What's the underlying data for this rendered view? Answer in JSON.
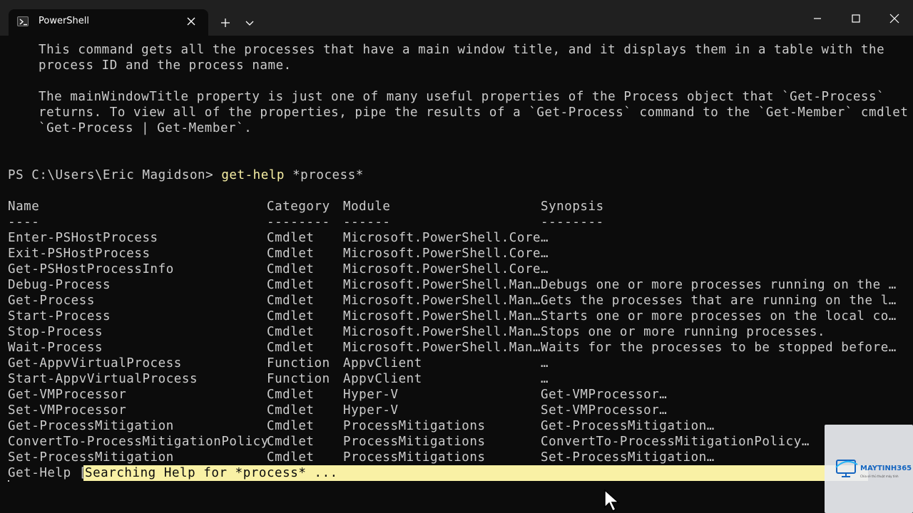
{
  "window": {
    "tab_title": "PowerShell"
  },
  "help_text": {
    "line1": "This command gets all the processes that have a main window title, and it displays them in a table with the",
    "line2": "process ID and the process name.",
    "line3": "The mainWindowTitle property is just one of many useful properties of the Process object that `Get-Process`",
    "line4": "returns. To view all of the properties, pipe the results of a `Get-Process` command to the `Get-Member` cmdlet",
    "line5": "`Get-Process | Get-Member`."
  },
  "prompt": {
    "path": "PS C:\\Users\\Eric Magidson> ",
    "command": "get-help",
    "argument": " *process*"
  },
  "table": {
    "headers": {
      "name": "Name",
      "category": "Category",
      "module": "Module",
      "synopsis": "Synopsis"
    },
    "underlines": {
      "name": "----",
      "category": "--------",
      "module": "------",
      "synopsis": "--------"
    },
    "rows": [
      {
        "name": "Enter-PSHostProcess",
        "category": "Cmdlet",
        "module": "Microsoft.PowerShell.Core",
        "synopsis": "…"
      },
      {
        "name": "Exit-PSHostProcess",
        "category": "Cmdlet",
        "module": "Microsoft.PowerShell.Core",
        "synopsis": "…"
      },
      {
        "name": "Get-PSHostProcessInfo",
        "category": "Cmdlet",
        "module": "Microsoft.PowerShell.Core",
        "synopsis": "…"
      },
      {
        "name": "Debug-Process",
        "category": "Cmdlet",
        "module": "Microsoft.PowerShell.Man…",
        "synopsis": "Debugs one or more processes running on the …"
      },
      {
        "name": "Get-Process",
        "category": "Cmdlet",
        "module": "Microsoft.PowerShell.Man…",
        "synopsis": "Gets the processes that are running on the l…"
      },
      {
        "name": "Start-Process",
        "category": "Cmdlet",
        "module": "Microsoft.PowerShell.Man…",
        "synopsis": "Starts one or more processes on the local co…"
      },
      {
        "name": "Stop-Process",
        "category": "Cmdlet",
        "module": "Microsoft.PowerShell.Man…",
        "synopsis": "Stops one or more running processes."
      },
      {
        "name": "Wait-Process",
        "category": "Cmdlet",
        "module": "Microsoft.PowerShell.Man…",
        "synopsis": "Waits for the processes to be stopped before…"
      },
      {
        "name": "Get-AppvVirtualProcess",
        "category": "Function",
        "module": "AppvClient",
        "synopsis": "…"
      },
      {
        "name": "Start-AppvVirtualProcess",
        "category": "Function",
        "module": "AppvClient",
        "synopsis": "…"
      },
      {
        "name": "Get-VMProcessor",
        "category": "Cmdlet",
        "module": "Hyper-V",
        "synopsis": "Get-VMProcessor…"
      },
      {
        "name": "Set-VMProcessor",
        "category": "Cmdlet",
        "module": "Hyper-V",
        "synopsis": "Set-VMProcessor…"
      },
      {
        "name": "Get-ProcessMitigation",
        "category": "Cmdlet",
        "module": "ProcessMitigations",
        "synopsis": "Get-ProcessMitigation…"
      },
      {
        "name": "ConvertTo-ProcessMitigationPolicy",
        "category": "Cmdlet",
        "module": "ProcessMitigations",
        "synopsis": "ConvertTo-ProcessMitigationPolicy…"
      },
      {
        "name": "Set-ProcessMitigation",
        "category": "Cmdlet",
        "module": "ProcessMitigations",
        "synopsis": "Set-ProcessMitigation…"
      }
    ]
  },
  "progress": {
    "activity": "Get-Help [",
    "status": "Searching Help for *process* ..."
  },
  "watermark": {
    "brand": "MAYTINH365",
    "tagline": "Chia sẻ thủ thuật máy tính"
  },
  "colors": {
    "background": "#0c0c0c",
    "text": "#cccccc",
    "header_green": "#16c60c",
    "command_yellow": "#f9f1a5",
    "titlebar": "#202020"
  }
}
